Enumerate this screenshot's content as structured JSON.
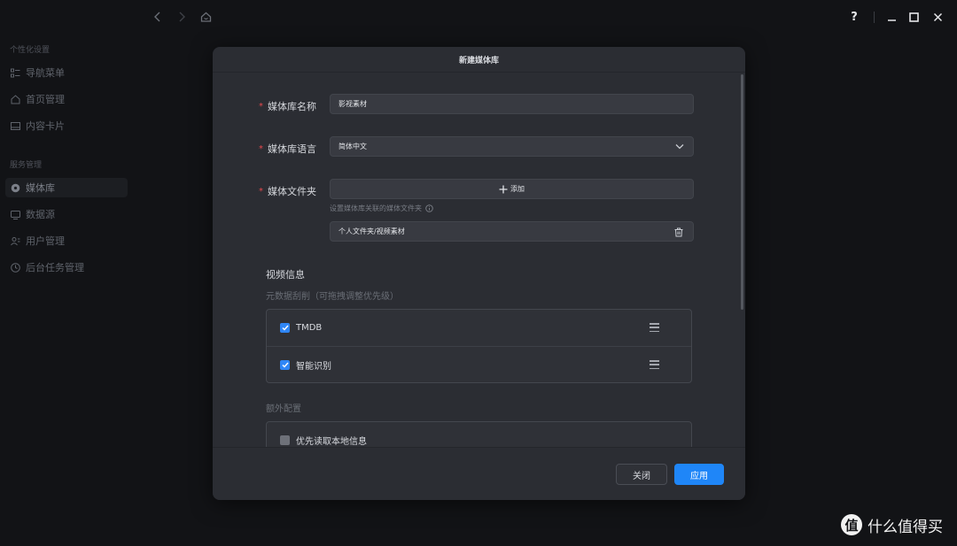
{
  "window": {
    "help_label": "?",
    "minimize_label": "—",
    "close_label": "✕"
  },
  "sidebar": {
    "sections": [
      {
        "title": "个性化设置",
        "items": [
          {
            "label": "导航菜单",
            "icon": "menu-icon"
          },
          {
            "label": "首页管理",
            "icon": "home-icon"
          },
          {
            "label": "内容卡片",
            "icon": "card-icon"
          }
        ]
      },
      {
        "title": "服务管理",
        "items": [
          {
            "label": "媒体库",
            "icon": "media-library-icon",
            "active": true
          },
          {
            "label": "数据源",
            "icon": "datasource-icon"
          },
          {
            "label": "用户管理",
            "icon": "users-icon"
          },
          {
            "label": "后台任务管理",
            "icon": "clock-icon"
          }
        ]
      }
    ]
  },
  "dialog": {
    "title": "新建媒体库",
    "required_mark": "*",
    "name_label": "媒体库名称",
    "name_value": "影视素材",
    "language_label": "媒体库语言",
    "language_value": "简体中文",
    "folder_label": "媒体文件夹",
    "add_label": "添加",
    "folder_hint": "设置媒体库关联的媒体文件夹",
    "folder_path": "个人文件夹/视频素材",
    "video_info_title": "视频信息",
    "metadata_title": "元数据刮削（可拖拽调整优先级）",
    "scrapers": [
      {
        "label": "TMDB",
        "checked": true
      },
      {
        "label": "智能识别",
        "checked": true
      }
    ],
    "extra_title": "额外配置",
    "extra_options": [
      {
        "label": "优先读取本地信息",
        "checked": false
      }
    ],
    "close_button": "关闭",
    "apply_button": "应用"
  },
  "watermark": {
    "logo": "值",
    "text": "什么值得买"
  },
  "colors": {
    "accent": "#1f86f8",
    "required": "#e5484d",
    "background": "#121316",
    "dialog": "#2b2d33"
  }
}
